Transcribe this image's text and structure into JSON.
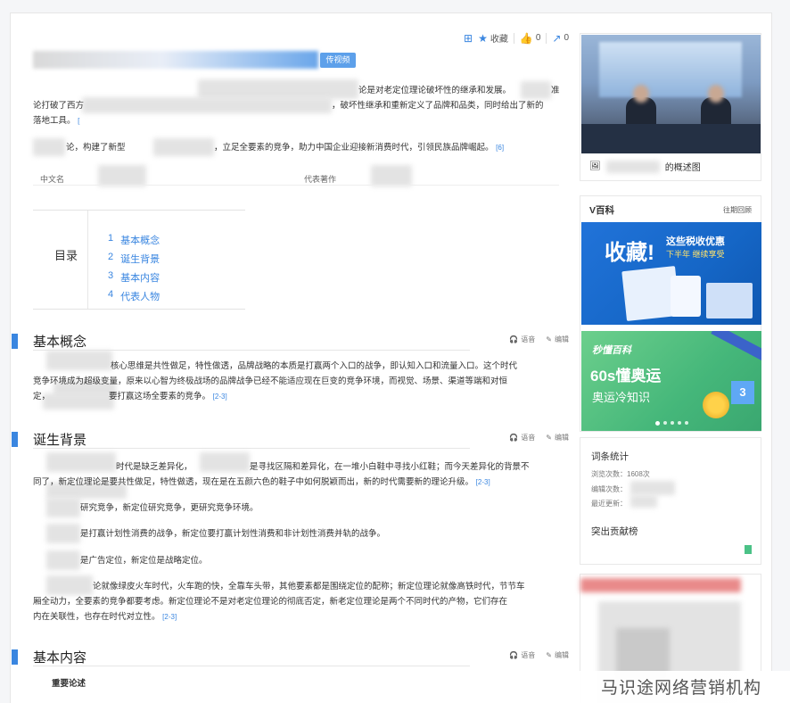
{
  "toolbar": {
    "favorite_label": "收藏",
    "like_count": "0",
    "share_count": "0"
  },
  "title": {
    "upload_video_label": "传视频"
  },
  "intro": {
    "line1_a": "论是对老定位理论破坏性的继承和发展。",
    "line1_b": "准",
    "line2_a": "论打破了西方",
    "line2_b": "，破坏性继承和重新定义了品牌和品类，同时给出了新的",
    "line3": "落地工具。",
    "ref1": "[",
    "line4_a": "论，构建了新型",
    "line4_b": "，立足全要素的竞争，助力中国企业迎接新消费时代，引领民族品牌崛起。",
    "ref2": "[6]"
  },
  "infobox": {
    "cn_name_label": "中文名",
    "works_label": "代表著作"
  },
  "toc": {
    "label": "目录",
    "items": [
      {
        "num": "1",
        "label": "基本概念"
      },
      {
        "num": "2",
        "label": "诞生背景"
      },
      {
        "num": "3",
        "label": "基本内容"
      },
      {
        "num": "4",
        "label": "代表人物"
      }
    ]
  },
  "actions": {
    "voice": "语音",
    "edit": "编辑"
  },
  "sections": {
    "s1": {
      "title": "基本概念",
      "line1": "核心思维是共性做足，特性做透，品牌战略的本质是打赢两个入口的战争，即认知入口和流量入口。这个时代",
      "line2": "竞争环境成为超级变量，原来以心智为终极战场的品牌战争已经不能适应现在巨变的竞争环境，而视觉、场景、渠道等端和对恒",
      "line3": "定，",
      "line3_b": "要打赢这场全要素的竞争。",
      "ref": "[2-3]"
    },
    "s2": {
      "title": "诞生背景",
      "line1_a": "时代是缺乏差异化，",
      "line1_b": "是寻找区隔和差异化，在一堆小白鞋中寻找小红鞋；而今天差异化的背景不",
      "line2_a": "同了，新定位理论是要共性做足，特性做透，现在是在五颜六色的鞋子中如何脱颖而出，新的时代需要新的理论升级。",
      "ref1": "[2-3]",
      "line3": "研究竞争，新定位研究竞争，更研究竞争环境。",
      "line4": "是打赢计划性消费的战争，新定位要打赢计划性消费和非计划性消费并轨的战争。",
      "line5": "是广告定位，新定位是战略定位。",
      "line6": "论就像绿皮火车时代，火车跑的快，全靠车头带，其他要素都是围绕定位的配称；新定位理论就像高铁时代，节节车",
      "line7": "厢全动力，全要素的竞争都要考虑。新定位理论不是对老定位理论的彻底否定，新老定位理论是两个不同时代的产物，它们存在",
      "line8": "内在关联性，也存在时代对立性。",
      "ref2": "[2-3]"
    },
    "s3": {
      "title": "基本内容",
      "sub": "重要论述"
    }
  },
  "sidebar": {
    "image_caption": "的概述图",
    "vbaike_title": "V百科",
    "vbaike_more": "往期回顾",
    "banner1": {
      "big": "收藏!",
      "sub": "这些税收优惠",
      "sub2": "下半年 继续享受"
    },
    "banner2": {
      "logo": "秒懂百科",
      "t1": "60s懂奥运",
      "t2": "奥运冷知识",
      "cube": "3"
    },
    "stats_title": "词条统计",
    "views_label": "浏览次数：",
    "views_value": "1608次",
    "edits_label": "编辑次数：",
    "updated_label": "最近更新：",
    "contrib_title": "突出贡献榜"
  },
  "watermark": "马识途网络营销机构"
}
